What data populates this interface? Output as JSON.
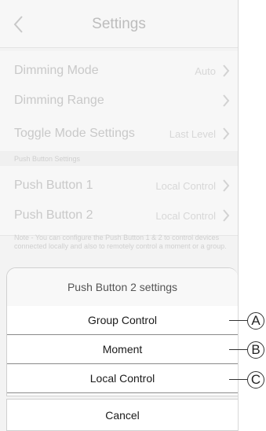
{
  "header": {
    "title": "Settings"
  },
  "rows": [
    {
      "label": "Dimming Mode",
      "value": "Auto"
    },
    {
      "label": "Dimming Range",
      "value": ""
    },
    {
      "label": "Toggle Mode Settings",
      "value": "Last Level"
    }
  ],
  "push_section": {
    "title": "Push Button Settings",
    "rows": [
      {
        "label": "Push Button 1",
        "value": "Local Control"
      },
      {
        "label": "Push Button 2",
        "value": "Local Control"
      }
    ],
    "note": "Note - You can configure the Push Button 1 & 2 to control devices connected locally and also to remotely control a moment or a group."
  },
  "sheet": {
    "title": "Push Button 2 settings",
    "options": [
      "Group Control",
      "Moment",
      "Local Control"
    ],
    "cancel": "Cancel"
  },
  "callouts": [
    "A",
    "B",
    "C"
  ],
  "icons": {
    "back": "chevron-left-icon",
    "row": "chevron-right-icon"
  }
}
